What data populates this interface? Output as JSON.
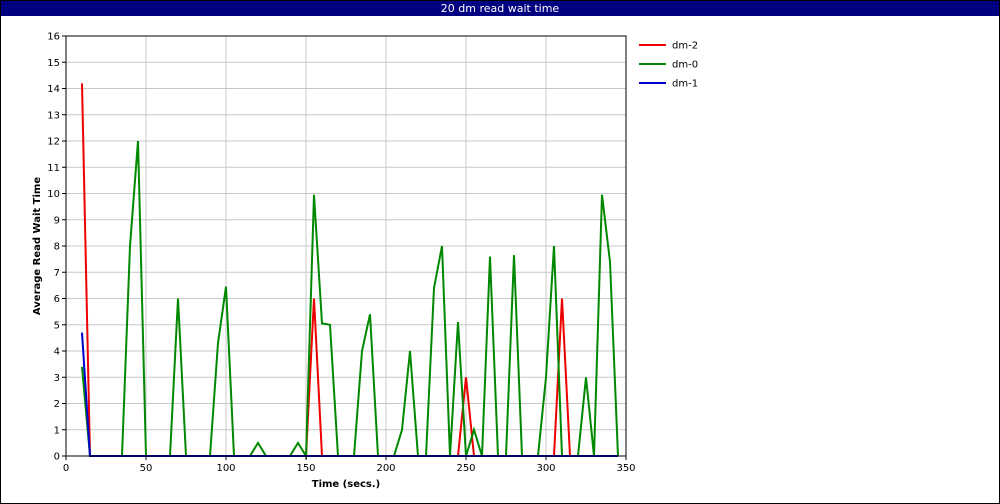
{
  "chart_data": {
    "type": "line",
    "title": "20 dm read wait time",
    "xlabel": "Time (secs.)",
    "ylabel": "Average Read Wait Time",
    "xlim": [
      0,
      350
    ],
    "ylim": [
      0,
      16
    ],
    "xticks": [
      0,
      50,
      100,
      150,
      200,
      250,
      300,
      350
    ],
    "yticks": [
      0,
      1,
      2,
      3,
      4,
      5,
      6,
      7,
      8,
      9,
      10,
      11,
      12,
      13,
      14,
      15,
      16
    ],
    "grid": true,
    "legend_position": "right",
    "series": [
      {
        "name": "dm-2",
        "color": "#ee0000",
        "points": [
          [
            10,
            14.2
          ],
          [
            15,
            0
          ],
          [
            150,
            0
          ],
          [
            155,
            6
          ],
          [
            160,
            0
          ],
          [
            245,
            0
          ],
          [
            250,
            3
          ],
          [
            255,
            0
          ],
          [
            305,
            0
          ],
          [
            310,
            6
          ],
          [
            315,
            0
          ],
          [
            345,
            0
          ]
        ]
      },
      {
        "name": "dm-0",
        "color": "#008800",
        "points": [
          [
            10,
            3.4
          ],
          [
            15,
            0
          ],
          [
            35,
            0
          ],
          [
            40,
            8
          ],
          [
            45,
            12
          ],
          [
            50,
            0
          ],
          [
            65,
            0
          ],
          [
            70,
            6
          ],
          [
            75,
            0
          ],
          [
            90,
            0
          ],
          [
            95,
            4.3
          ],
          [
            100,
            6.45
          ],
          [
            105,
            0
          ],
          [
            115,
            0
          ],
          [
            120,
            0.5
          ],
          [
            125,
            0
          ],
          [
            140,
            0
          ],
          [
            145,
            0.5
          ],
          [
            150,
            0
          ],
          [
            155,
            9.95
          ],
          [
            160,
            5.05
          ],
          [
            165,
            5
          ],
          [
            170,
            0
          ],
          [
            180,
            0
          ],
          [
            185,
            4
          ],
          [
            190,
            5.4
          ],
          [
            195,
            0
          ],
          [
            205,
            0
          ],
          [
            210,
            1
          ],
          [
            215,
            4
          ],
          [
            220,
            0
          ],
          [
            225,
            0
          ],
          [
            230,
            6.4
          ],
          [
            235,
            8
          ],
          [
            240,
            0
          ],
          [
            245,
            5.1
          ],
          [
            250,
            0
          ],
          [
            255,
            1
          ],
          [
            260,
            0
          ],
          [
            265,
            7.6
          ],
          [
            270,
            0
          ],
          [
            275,
            0
          ],
          [
            280,
            7.65
          ],
          [
            285,
            0
          ],
          [
            295,
            0
          ],
          [
            300,
            3
          ],
          [
            305,
            8
          ],
          [
            310,
            0
          ],
          [
            320,
            0
          ],
          [
            325,
            3
          ],
          [
            330,
            0
          ],
          [
            335,
            9.95
          ],
          [
            340,
            7.4
          ],
          [
            345,
            0
          ]
        ]
      },
      {
        "name": "dm-1",
        "color": "#0000cc",
        "points": [
          [
            10,
            4.7
          ],
          [
            15,
            0
          ],
          [
            345,
            0
          ]
        ]
      }
    ]
  }
}
